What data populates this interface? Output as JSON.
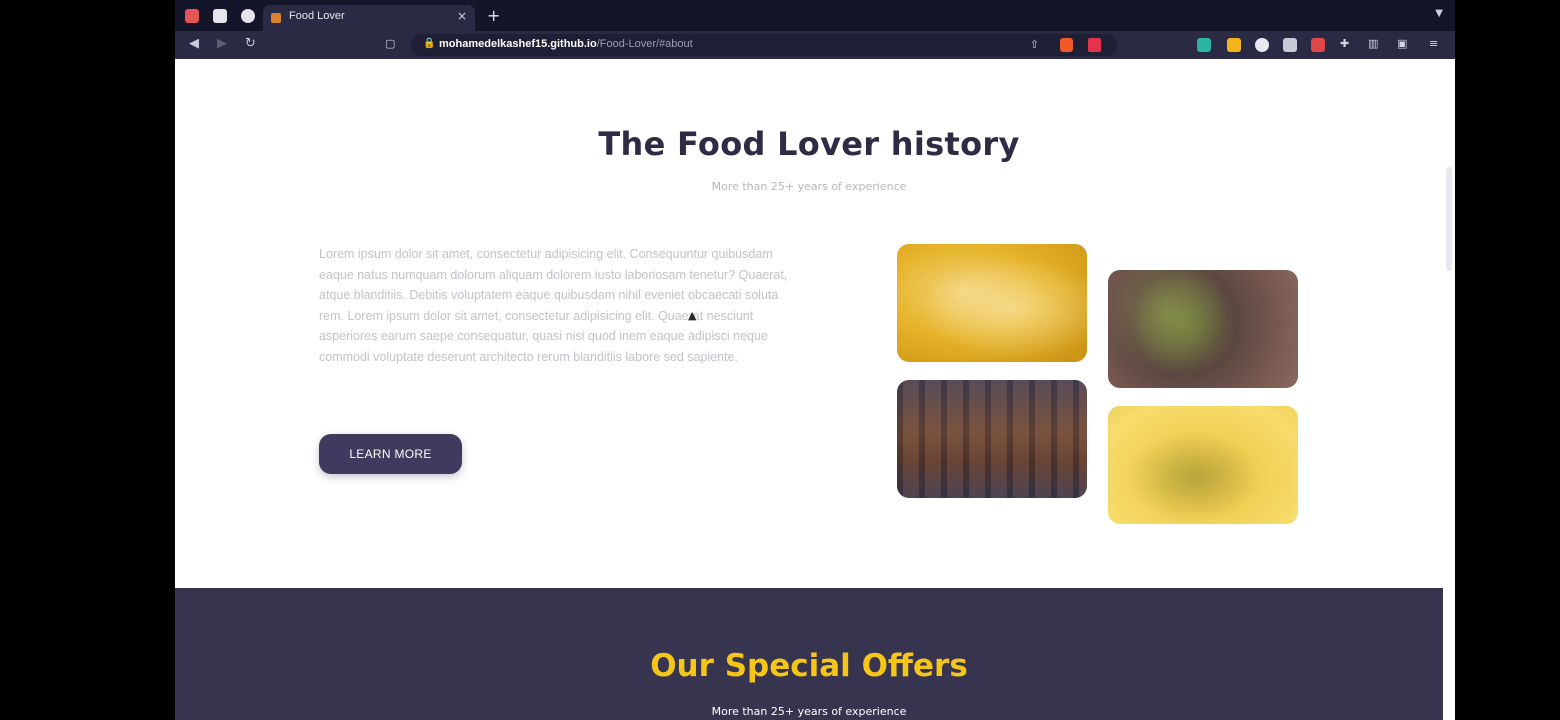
{
  "browser": {
    "tab_title": "Food Lover",
    "tab_close": "×",
    "new_tab": "+",
    "url_host": "mohamedelkashef15.github.io",
    "url_path": "/Food-Lover/#about"
  },
  "history": {
    "title": "The Food Lover history",
    "subtitle": "More than 25+ years of experience",
    "paragraph": "Lorem ipsum dolor sit amet, consectetur adipisicing elit. Consequuntur quibusdam eaque natus numquam dolorum aliquam dolorem iusto laboriosam tenetur? Quaerat, atque blanditiis. Debitis voluptatem eaque quibusdam nihil eveniet obcaecati soluta rem. Lorem ipsum dolor sit amet, consectetur adipisicing elit. Quaerat nesciunt asperiores earum saepe consequatur, quasi nisi quod inem eaque adipisci neque commodi voluptate deserunt architecto rerum blanditiis labore sed sapiente.",
    "button_label": "LEARN MORE"
  },
  "offers": {
    "title": "Our Special Offers",
    "subtitle": "More than 25+ years of experience"
  },
  "colors": {
    "accent": "#3f3b5e",
    "offers_title": "#f5c518",
    "dark_section": "#37344f"
  }
}
